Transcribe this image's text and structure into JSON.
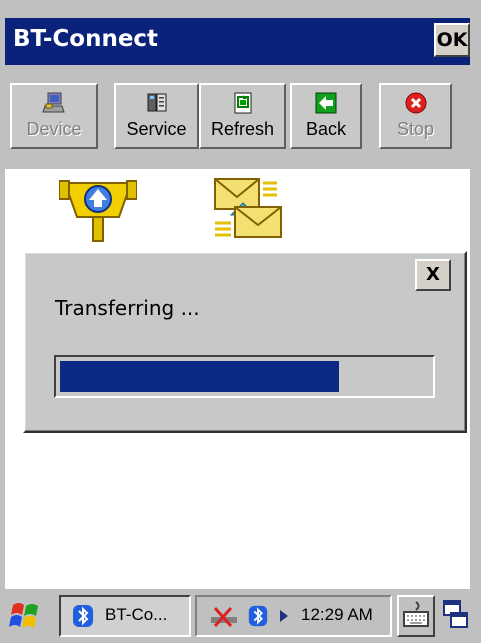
{
  "window": {
    "title": "BT-Connect",
    "ok_label": "OK"
  },
  "toolbar": {
    "buttons": [
      {
        "label": "Device",
        "icon": "computer-icon",
        "enabled": false
      },
      {
        "label": "Service",
        "icon": "services-icon",
        "enabled": true
      },
      {
        "label": "Refresh",
        "icon": "refresh-icon",
        "enabled": true
      },
      {
        "label": "Back",
        "icon": "back-arrow-icon",
        "enabled": true
      },
      {
        "label": "Stop",
        "icon": "stop-icon",
        "enabled": false
      }
    ]
  },
  "content": {
    "icons": [
      "serial-port-icon",
      "mail-transfer-icon"
    ]
  },
  "dialog": {
    "close_label": "X",
    "message": "Transferring ...",
    "progress_fraction": 0.76
  },
  "taskbar": {
    "task_label": "BT-Co...",
    "clock": "12:29 AM"
  },
  "colors": {
    "title_bar": "#0b227a",
    "progress_fill": "#0b2a84"
  }
}
